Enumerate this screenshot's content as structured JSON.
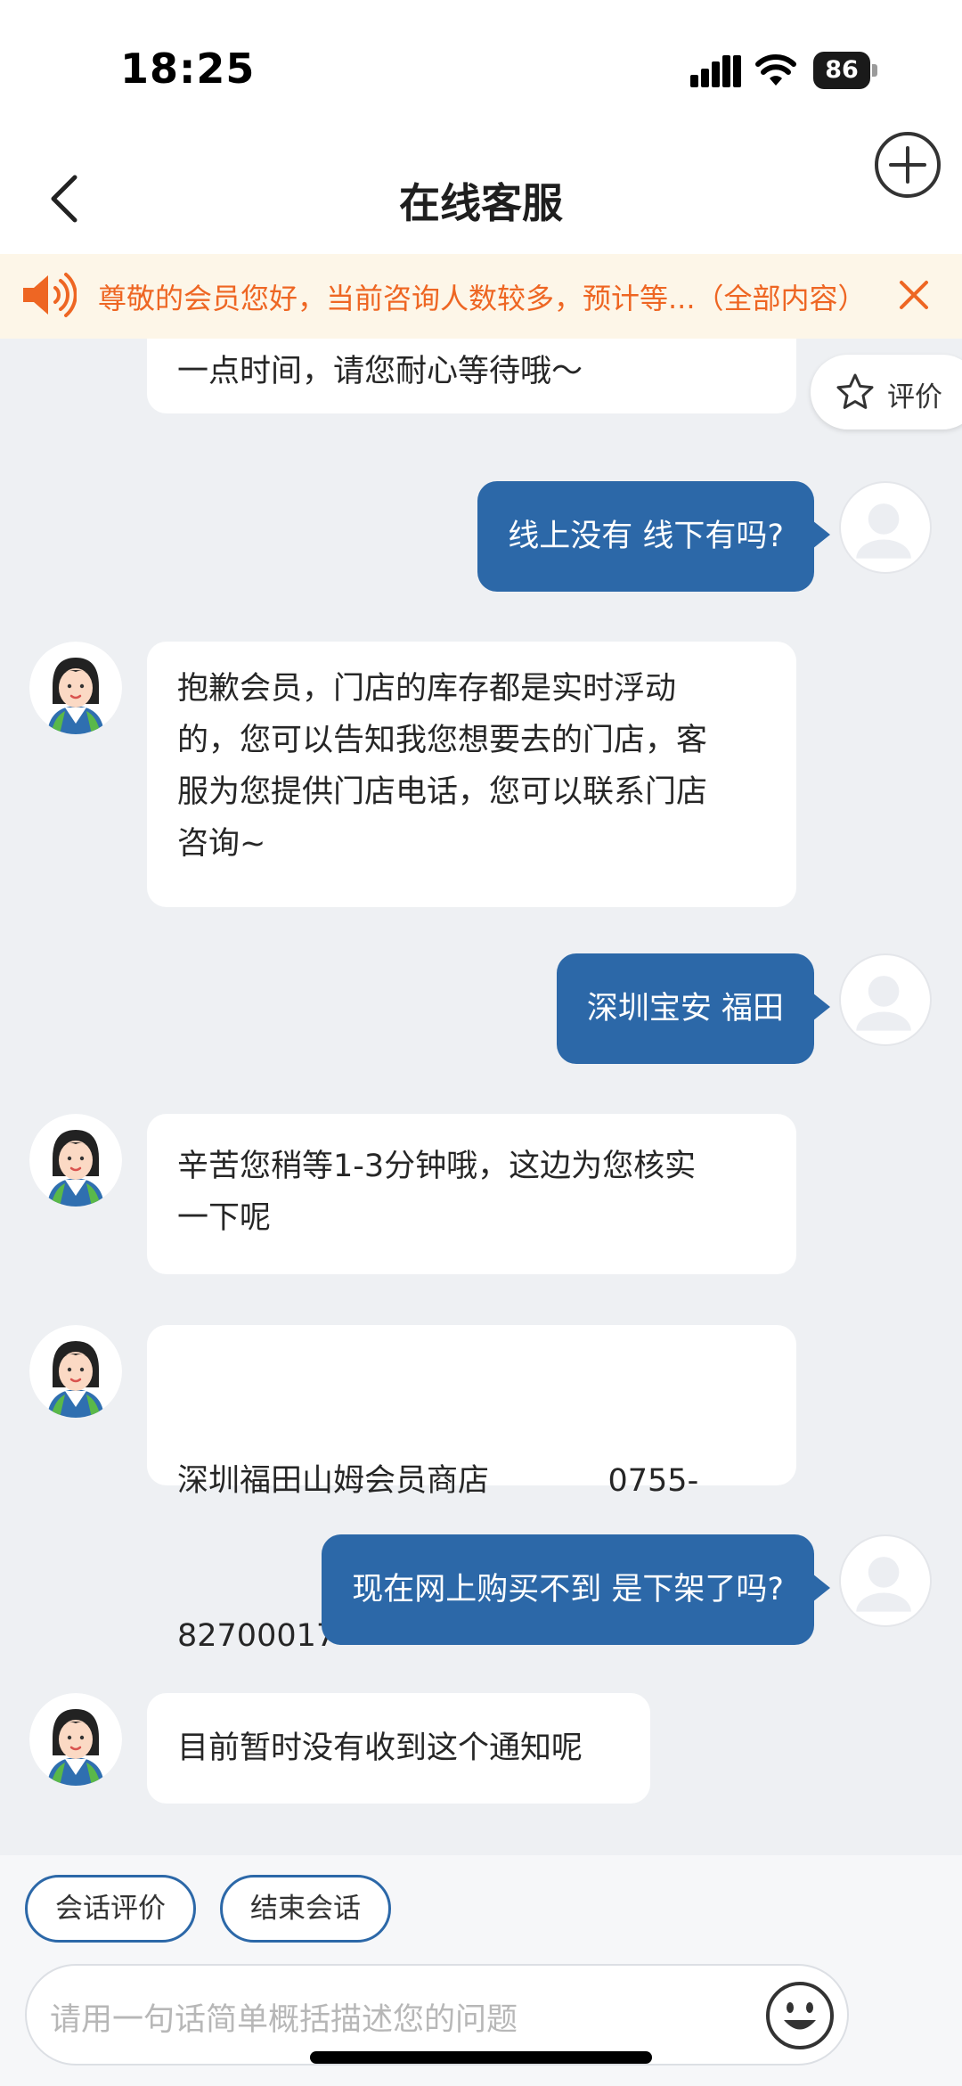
{
  "status_bar": {
    "time": "18:25",
    "battery": "86"
  },
  "header": {
    "title": "在线客服"
  },
  "notice": {
    "text": "尊敬的会员您好，当前咨询人数较多，预计等...（全部内容）"
  },
  "rate_chip": {
    "label": "评价"
  },
  "messages": [
    {
      "from": "bot",
      "lines": [
        "一点时间，请您耐心等待哦～"
      ]
    },
    {
      "from": "user",
      "lines": [
        "线上没有 线下有吗?"
      ]
    },
    {
      "from": "bot",
      "lines": [
        "抱歉会员，门店的库存都是实时浮动",
        "的，您可以告知我您想要去的门店，客",
        "服为您提供门店电话，您可以联系门店",
        "咨询~"
      ]
    },
    {
      "from": "user",
      "lines": [
        "深圳宝安 福田"
      ]
    },
    {
      "from": "bot",
      "lines": [
        "辛苦您稍等1-3分钟哦，这边为您核实",
        "一下呢"
      ]
    },
    {
      "from": "bot",
      "lines": [
        "深圳福田山姆会员商店            0755-",
        "82700017"
      ]
    },
    {
      "from": "user",
      "lines": [
        "现在网上购买不到 是下架了吗?"
      ]
    },
    {
      "from": "bot",
      "lines": [
        "目前暂时没有收到这个通知呢"
      ]
    }
  ],
  "actions": {
    "rate_label": "会话评价",
    "end_label": "结束会话"
  },
  "input": {
    "placeholder": "请用一句话简单概括描述您的问题"
  },
  "colors": {
    "accent": "#2c68a8",
    "notice_text": "#ee6623",
    "notice_bg": "#fdf6e8"
  }
}
